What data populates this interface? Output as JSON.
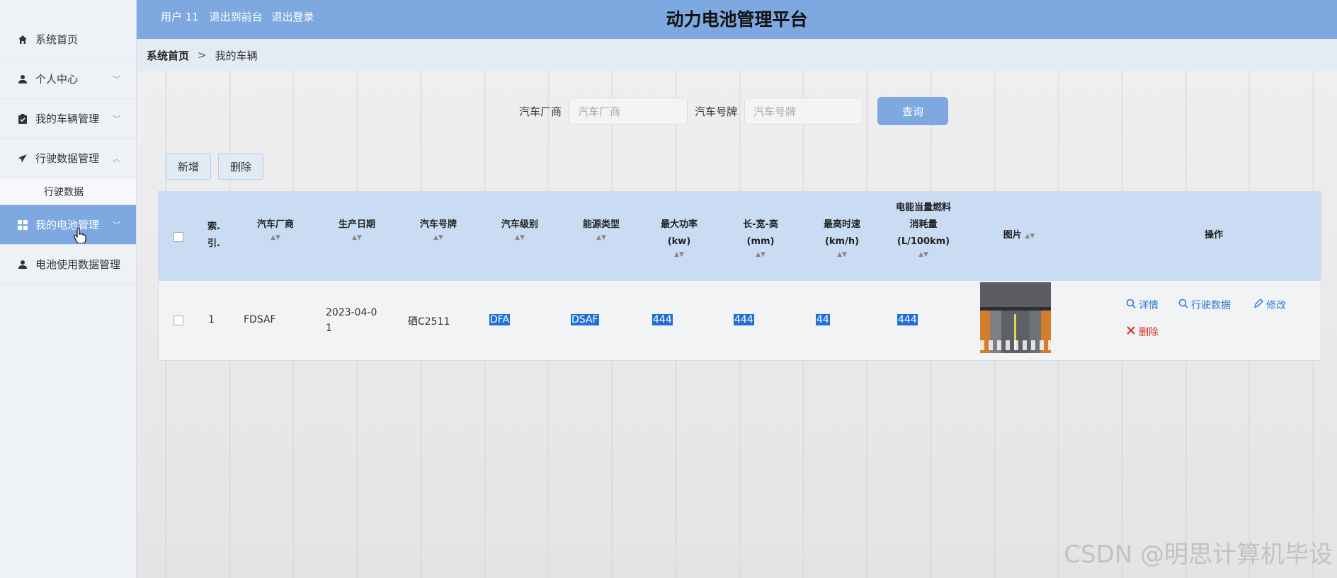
{
  "header": {
    "user_link": "用户 11",
    "front_link": "退出到前台",
    "logout_link": "退出登录",
    "title": "动力电池管理平台"
  },
  "sidebar": {
    "items": [
      {
        "label": "系统首页",
        "icon": "home-icon"
      },
      {
        "label": "个人中心",
        "icon": "user-icon"
      },
      {
        "label": "我的车辆管理",
        "icon": "clipboard-icon"
      },
      {
        "label": "行驶数据管理",
        "icon": "send-icon"
      },
      {
        "label": "行驶数据",
        "icon": ""
      },
      {
        "label": "我的电池管理",
        "icon": "grid-icon"
      },
      {
        "label": "电池使用数据管理",
        "icon": "user-icon"
      }
    ]
  },
  "breadcrumb": {
    "home": "系统首页",
    "separator": ">",
    "current": "我的车辆"
  },
  "search": {
    "maker_label": "汽车厂商",
    "maker_placeholder": "汽车厂商",
    "plate_label": "汽车号牌",
    "plate_placeholder": "汽车号牌",
    "query_button": "查询"
  },
  "toolbar": {
    "add_label": "新增",
    "delete_label": "删除"
  },
  "table": {
    "headers": [
      "索.引.",
      "汽车厂商",
      "生产日期",
      "汽车号牌",
      "汽车级别",
      "能源类型",
      "最大功率(kw)",
      "长-宽-高(mm)",
      "最高时速(km/h)",
      "电能当量燃料消耗量(L/100km)",
      "图片",
      "操作"
    ],
    "rows": [
      {
        "index": "1",
        "maker": "FDSAF",
        "date": "2023-04-01",
        "plate": "硒C2511",
        "level": "DFA",
        "energy": "DSAF",
        "power": "444",
        "size": "444",
        "speed": "44",
        "consumption": "444"
      }
    ],
    "ops": {
      "detail": "详情",
      "driving": "行驶数据",
      "edit": "修改",
      "delete": "删除"
    }
  },
  "watermark": "CSDN @明思计算机毕设",
  "colors": {
    "primary": "#7ea8e0",
    "link": "#2d7bd7",
    "danger": "#d93025",
    "highlight": "#1f6fd6"
  }
}
